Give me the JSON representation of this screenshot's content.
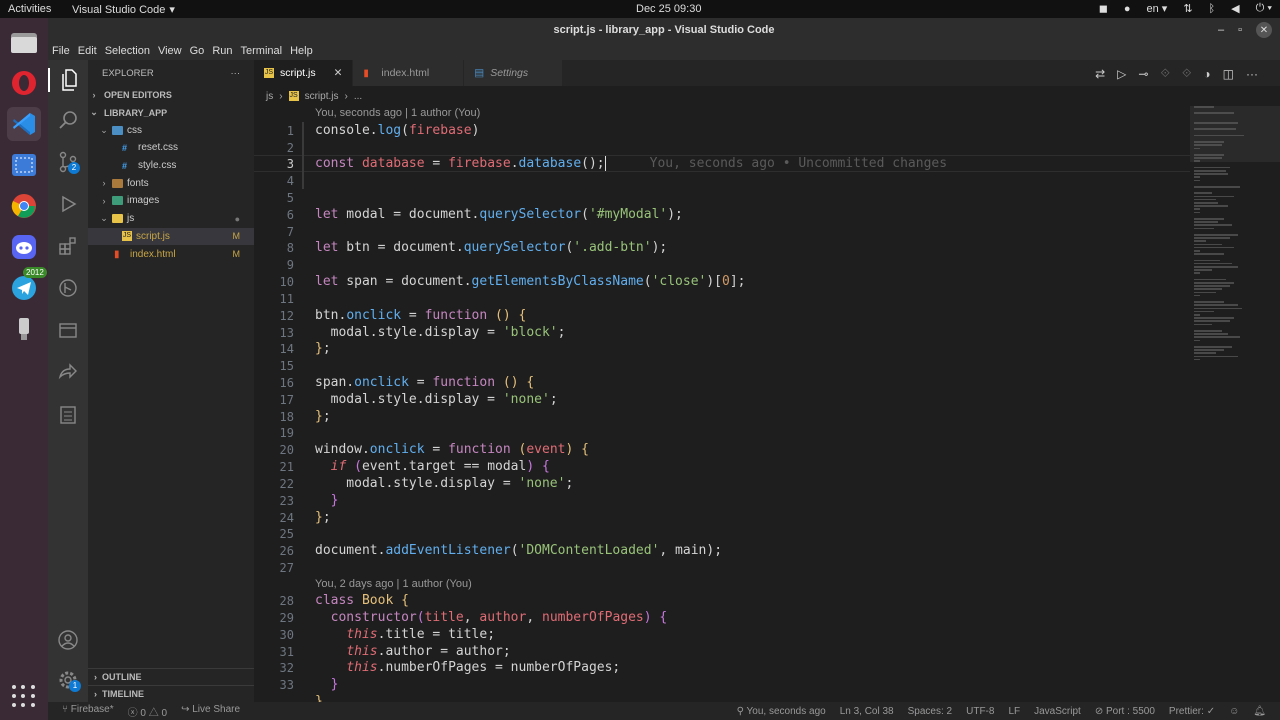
{
  "topbar": {
    "activities": "Activities",
    "app": "Visual Studio Code",
    "clock": "Dec 25  09:30",
    "lang": "en"
  },
  "dock": {
    "telegram_badge": "2012"
  },
  "window": {
    "title": "script.js - library_app - Visual Studio Code"
  },
  "menu": [
    "File",
    "Edit",
    "Selection",
    "View",
    "Go",
    "Run",
    "Terminal",
    "Help"
  ],
  "activity": {
    "scm_badge": "2",
    "settings_badge": "1"
  },
  "explorer": {
    "header": "EXPLORER",
    "open_editors": "OPEN EDITORS",
    "project": "LIBRARY_APP",
    "items": [
      {
        "label": "css",
        "type": "folder-open"
      },
      {
        "label": "reset.css",
        "type": "css"
      },
      {
        "label": "style.css",
        "type": "css"
      },
      {
        "label": "fonts",
        "type": "folder"
      },
      {
        "label": "images",
        "type": "folder"
      },
      {
        "label": "js",
        "type": "folder-open"
      },
      {
        "label": "script.js",
        "type": "js",
        "mark": "M"
      },
      {
        "label": "index.html",
        "type": "html",
        "mark": "M"
      }
    ],
    "outline": "OUTLINE",
    "timeline": "TIMELINE"
  },
  "tabs": [
    {
      "label": "script.js",
      "active": true
    },
    {
      "label": "index.html"
    },
    {
      "label": "Settings"
    }
  ],
  "breadcrumb": {
    "folder": "js",
    "file": "script.js",
    "more": "..."
  },
  "blame1": "You, seconds ago | 1 author (You)",
  "blame2": "You, 2 days ago | 1 author (You)",
  "ghost": "You, seconds ago • Uncommitted changes",
  "line_numbers": [
    "1",
    "2",
    "3",
    "4",
    "5",
    "6",
    "7",
    "8",
    "9",
    "10",
    "11",
    "12",
    "13",
    "14",
    "15",
    "16",
    "17",
    "18",
    "19",
    "20",
    "21",
    "22",
    "23",
    "24",
    "25",
    "26",
    "27",
    "28",
    "29",
    "30",
    "31",
    "32",
    "33"
  ],
  "status": {
    "branch": "Firebase*",
    "problems": "0",
    "warnings": "0",
    "liveshare": "Live Share",
    "blame": "You, seconds ago",
    "position": "Ln 3, Col 38",
    "spaces": "Spaces: 2",
    "encoding": "UTF-8",
    "eol": "LF",
    "language": "JavaScript",
    "port": "Port : 5500",
    "prettier": "Prettier: ✓"
  }
}
